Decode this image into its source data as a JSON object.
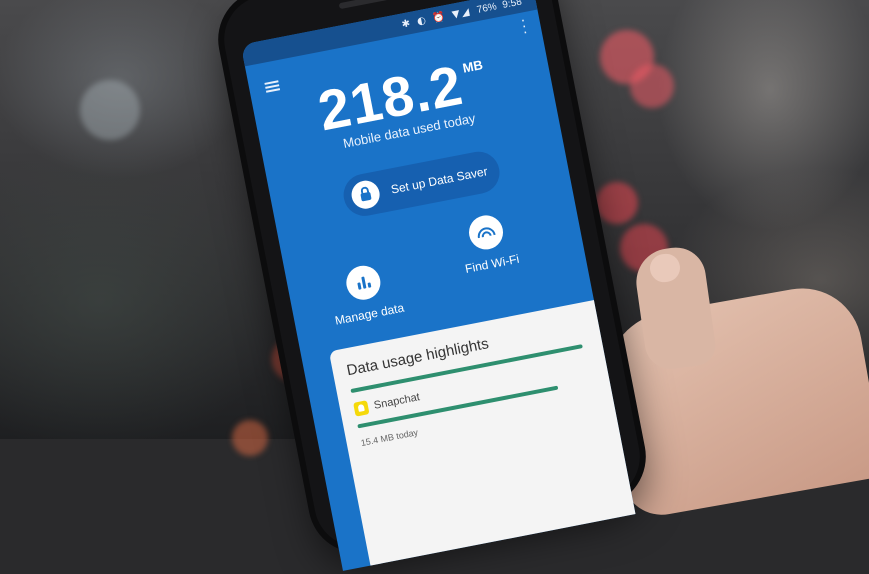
{
  "app": {
    "status_bar_icons": "✱ ◐ ⏰ ▼◢",
    "battery": "76%",
    "time": "9:58"
  },
  "usage": {
    "value": "218.2",
    "unit": "MB",
    "caption": "Mobile data used today"
  },
  "saver_button": {
    "label": "Set up Data Saver"
  },
  "actions": {
    "manage_label": "Manage data",
    "wifi_label": "Find Wi-Fi"
  },
  "highlights": {
    "title": "Data usage highlights",
    "app_name": "Snapchat",
    "app_detail": "15.4 MB today"
  },
  "colors": {
    "primary": "#1a73c8",
    "accent_bar": "#2e8f6f",
    "card": "#f4f4f4"
  },
  "icons": [
    "menu-icon",
    "kebab-icon",
    "lock-icon",
    "bars-icon",
    "wifi-icon",
    "snapchat-icon"
  ]
}
